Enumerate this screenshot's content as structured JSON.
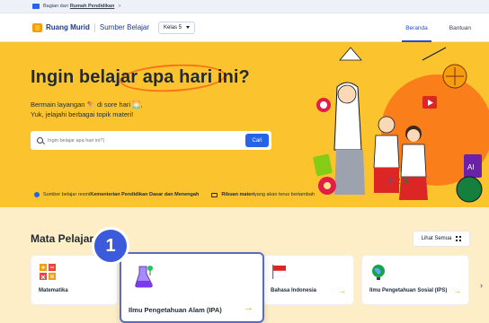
{
  "topbar": {
    "prefix": "Bagian dari",
    "link": "Rumah Pendidikan",
    "chevron": ">"
  },
  "navbar": {
    "brand": "Ruang Murid",
    "brand_sub": "Sumber Belajar",
    "grade_select": "Kelas 5",
    "items": [
      {
        "label": "Beranda",
        "active": true
      },
      {
        "label": "Bantuan",
        "active": false
      }
    ]
  },
  "hero": {
    "title_pre": "Ingin belajar ",
    "title_highlight": "apa hari ini?",
    "subtitle_line1": "Bermain layangan 🪁 di sore hari 🌅,",
    "subtitle_line2": "Yuk, jelajahi berbagai topik materi!",
    "search_placeholder": "Ingin belajar apa hari ini?|",
    "search_button": "Cari",
    "footer_text1_pre": "Sumber belajar resmi ",
    "footer_text1_bold": "Kementerian Pendidikan Dasar dan Menengah",
    "footer_text2_bold": "Ribuan materi",
    "footer_text2_post": " yang akan terus bertambah"
  },
  "mapel": {
    "title": "Mata Pelajaran",
    "see_all": "Lihat Semua",
    "cards": [
      {
        "label": "Matematika",
        "icon": "math-icon"
      },
      {
        "label": "Bahasa Indonesia",
        "icon": "flag-icon"
      },
      {
        "label": "Ilmu Pengetahuan Sosial (IPS)",
        "icon": "globe-icon"
      }
    ],
    "featured": {
      "label": "Ilmu Pengetahuan Alam (IPA)",
      "icon": "flask-icon"
    },
    "arrow": "→",
    "next": "›"
  },
  "step_badge": "1",
  "colors": {
    "hero_bg": "#fbc42f",
    "accent": "#2563eb",
    "section_bg": "#fdeec7",
    "highlight": "#f97316"
  }
}
